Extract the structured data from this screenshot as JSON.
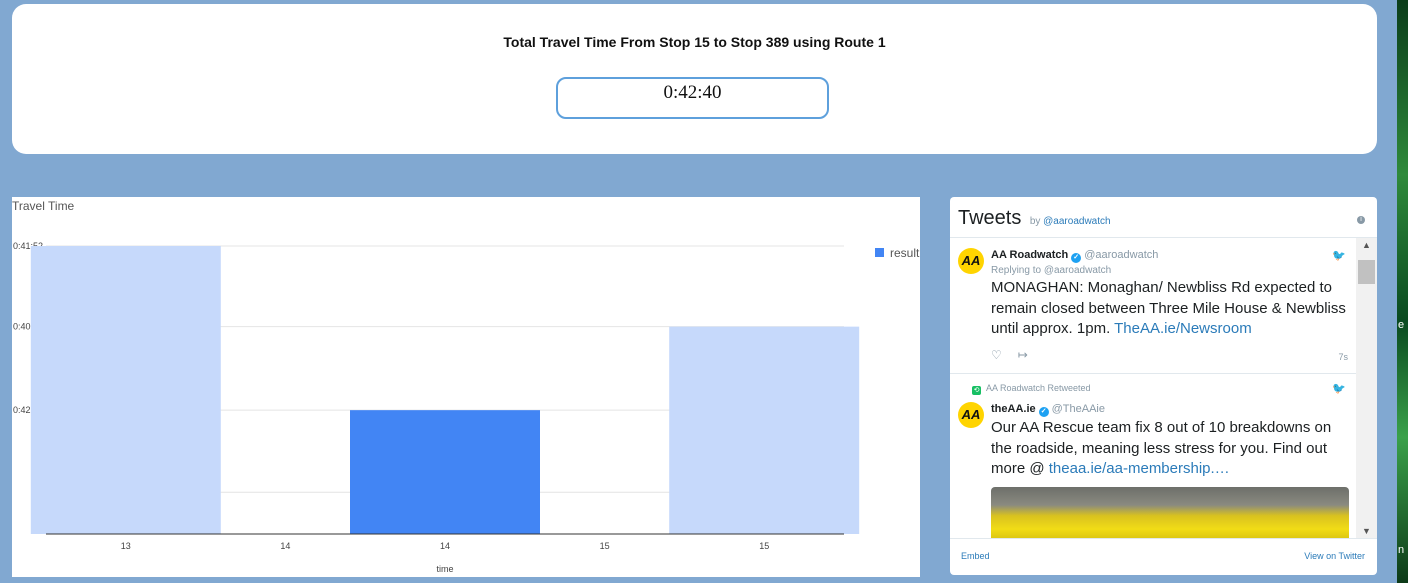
{
  "summary": {
    "title": "Total Travel Time From Stop 15 to Stop 389 using Route 1",
    "total_time": "0:42:40"
  },
  "chart_data": {
    "type": "bar",
    "title": "Travel Time",
    "xlabel": "time",
    "ylabel": "",
    "categories": [
      "13",
      "14",
      "14",
      "15",
      "15"
    ],
    "series": [
      {
        "name": "result",
        "values": [
          "0:41:52",
          null,
          "0:42:40",
          null,
          "0:40:48"
        ]
      }
    ],
    "value_levels": {
      "0:41:52": 1.0,
      "0:40:48": 0.72,
      "0:42:40": 0.43
    },
    "y_ticks": [
      "0:41:52",
      "0:40:48",
      "0:42:40"
    ],
    "highlighted_category_index": 2,
    "colors": {
      "highlight": "#4285f4",
      "normal": "#c6d9fb"
    },
    "legend_position": "top-right",
    "grid": true
  },
  "tweets_widget": {
    "title": "Tweets",
    "by_text": "by",
    "by_handle": "@aaroadwatch",
    "info_icon": "info-icon",
    "tweets": [
      {
        "author": "AA Roadwatch",
        "handle": "@aaroadwatch",
        "avatar_text": "AA",
        "reply_prefix": "Replying to",
        "reply_handle": "@aaroadwatch",
        "text": "MONAGHAN: Monaghan/ Newbliss Rd expected to remain closed between Three Mile House & Newbliss until approx. 1pm.",
        "link": "TheAA.ie/Newsroom",
        "time": "7s"
      },
      {
        "retweeted_by": "AA Roadwatch Retweeted",
        "author": "theAA.ie",
        "handle": "@TheAAie",
        "avatar_text": "AA",
        "text": "Our AA Rescue team fix 8 out of 10 breakdowns on the roadside, meaning less stress for you. Find out more @",
        "link": "theaa.ie/aa-membership.…"
      }
    ],
    "footer_embed": "Embed",
    "footer_view": "View on Twitter"
  },
  "right_edge_letters": [
    "e",
    "n"
  ]
}
